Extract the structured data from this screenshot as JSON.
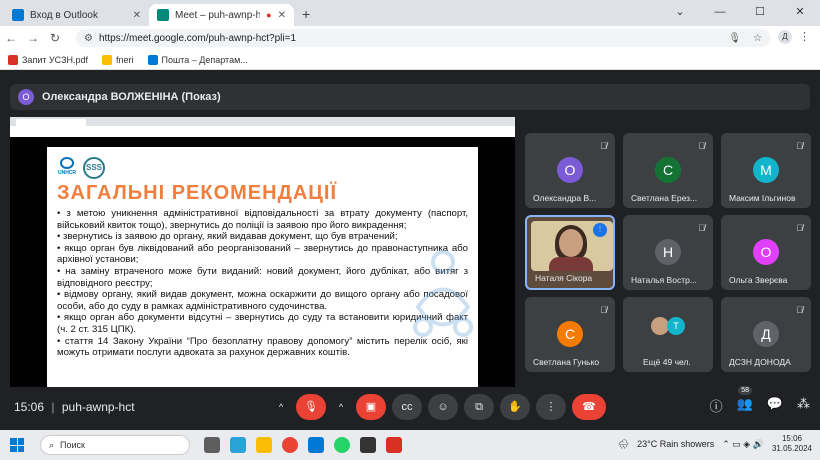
{
  "browser": {
    "tabs": [
      {
        "title": "Вход в Outlook",
        "favicon_color": "#0078d4",
        "active": false
      },
      {
        "title": "Meet – puh-awnp-hct",
        "favicon_color": "#00897b",
        "active": true
      }
    ],
    "url": "https://meet.google.com/puh-awnp-hct?pli=1",
    "profile_initial": "Д",
    "bookmarks": [
      {
        "label": "Запит УСЗН.pdf",
        "color": "#d93025"
      },
      {
        "label": "fneri",
        "color": "#fbbc04"
      },
      {
        "label": "Пошта – Департам...",
        "color": "#0078d4"
      }
    ]
  },
  "meet": {
    "presenter_initial": "О",
    "presenter_label": "Олександра ВОЛЖЕНІНА (Показ)",
    "slide": {
      "unhcr": "UNHCR",
      "sss": "SSS",
      "title": "ЗАГАЛЬНІ РЕКОМЕНДАЦІЇ",
      "bullets": [
        "•  з метою уникнення адміністративної відповідальності за втрату документу (паспорт, військовий квиток тощо), звернутись до поліції із заявою про його викрадення;",
        "•  звернутись із заявою до органу, який видавав документ, що був втрачений;",
        "•  якщо орган був ліквідований або реорганізований – звернутись до правонаступника або архівної установи;",
        "•  на заміну втраченого може бути виданий: новий документ, його дублікат, або витяг з відповідного реєстру;",
        "•  відмову органу, який видав документ, можна оскаржити до вищого органу або посадової особи, або до суду в рамках адміністративного судочинства.",
        "•  якщо орган або документи відсутні – звернутись до суду та встановити юридичний факт (ч. 2 ст. 315 ЦПК).",
        "•  стаття 14 Закону України “Про безоплатну правову допомогу” містить перелік осіб, які можуть отримати послуги адвоката за рахунок державних коштів."
      ]
    },
    "participants": [
      {
        "initial": "О",
        "name": "Олександра В...",
        "color": "#7b5cd6"
      },
      {
        "initial": "С",
        "name": "Светлана Ерез...",
        "color": "#137333"
      },
      {
        "initial": "М",
        "name": "Максим Ільгинов",
        "color": "#12b5cb"
      },
      {
        "initial": "",
        "name": "Наталя Сікора",
        "color": ""
      },
      {
        "initial": "Н",
        "name": "Наталья Востр...",
        "color": "#5f6368"
      },
      {
        "initial": "О",
        "name": "Ольга Зверєва",
        "color": "#e040fb"
      },
      {
        "initial": "С",
        "name": "Светлана Гунько",
        "color": "#f57c00"
      },
      {
        "initial": "Т",
        "name": "Ещё 49 чел.",
        "color": "#12b5cb"
      },
      {
        "initial": "Д",
        "name": "ДСЗН ДОНОДА",
        "color": "#5f6368"
      }
    ],
    "time": "15:06",
    "meeting_code": "puh-awnp-hct",
    "participants_count": "58"
  },
  "taskbar": {
    "search_label": "Поиск",
    "weather": "23°C  Rain showers",
    "time": "15:06",
    "date": "31.05.2024"
  }
}
